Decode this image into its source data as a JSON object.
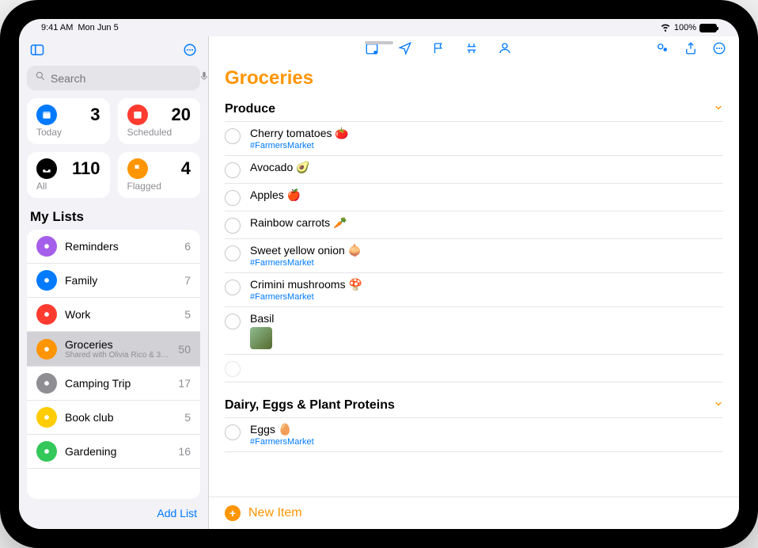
{
  "status": {
    "time": "9:41 AM",
    "date": "Mon Jun 5",
    "battery": "100%"
  },
  "search": {
    "placeholder": "Search"
  },
  "cards": {
    "today": {
      "label": "Today",
      "count": "3"
    },
    "scheduled": {
      "label": "Scheduled",
      "count": "20"
    },
    "all": {
      "label": "All",
      "count": "110"
    },
    "flagged": {
      "label": "Flagged",
      "count": "4"
    }
  },
  "sidebar": {
    "section": "My Lists",
    "add_list": "Add List",
    "lists": [
      {
        "name": "Reminders",
        "count": "6",
        "color": "#a55eea",
        "icon": "list"
      },
      {
        "name": "Family",
        "count": "7",
        "color": "#007aff",
        "icon": "house"
      },
      {
        "name": "Work",
        "count": "5",
        "color": "#ff3b30",
        "icon": "star"
      },
      {
        "name": "Groceries",
        "count": "50",
        "color": "#ff9500",
        "icon": "cart",
        "sub": "Shared with Olivia Rico & 3…",
        "selected": true
      },
      {
        "name": "Camping Trip",
        "count": "17",
        "color": "#8e8e93",
        "icon": "tent"
      },
      {
        "name": "Book club",
        "count": "5",
        "color": "#ffcc00",
        "icon": "bookmark"
      },
      {
        "name": "Gardening",
        "count": "16",
        "color": "#34c759",
        "icon": "leaf"
      }
    ]
  },
  "main": {
    "title": "Groceries",
    "title_color": "#ff9500",
    "new_item": "New Item",
    "groups": [
      {
        "name": "Produce",
        "items": [
          {
            "title": "Cherry tomatoes 🍅",
            "tag": "#FarmersMarket"
          },
          {
            "title": "Avocado 🥑"
          },
          {
            "title": "Apples 🍎"
          },
          {
            "title": "Rainbow carrots 🥕"
          },
          {
            "title": "Sweet yellow onion 🧅",
            "tag": "#FarmersMarket"
          },
          {
            "title": "Crimini mushrooms 🍄",
            "tag": "#FarmersMarket"
          },
          {
            "title": "Basil",
            "thumb": true
          }
        ]
      },
      {
        "name": "Dairy, Eggs & Plant Proteins",
        "items": [
          {
            "title": "Eggs 🥚",
            "tag": "#FarmersMarket"
          }
        ]
      }
    ]
  }
}
